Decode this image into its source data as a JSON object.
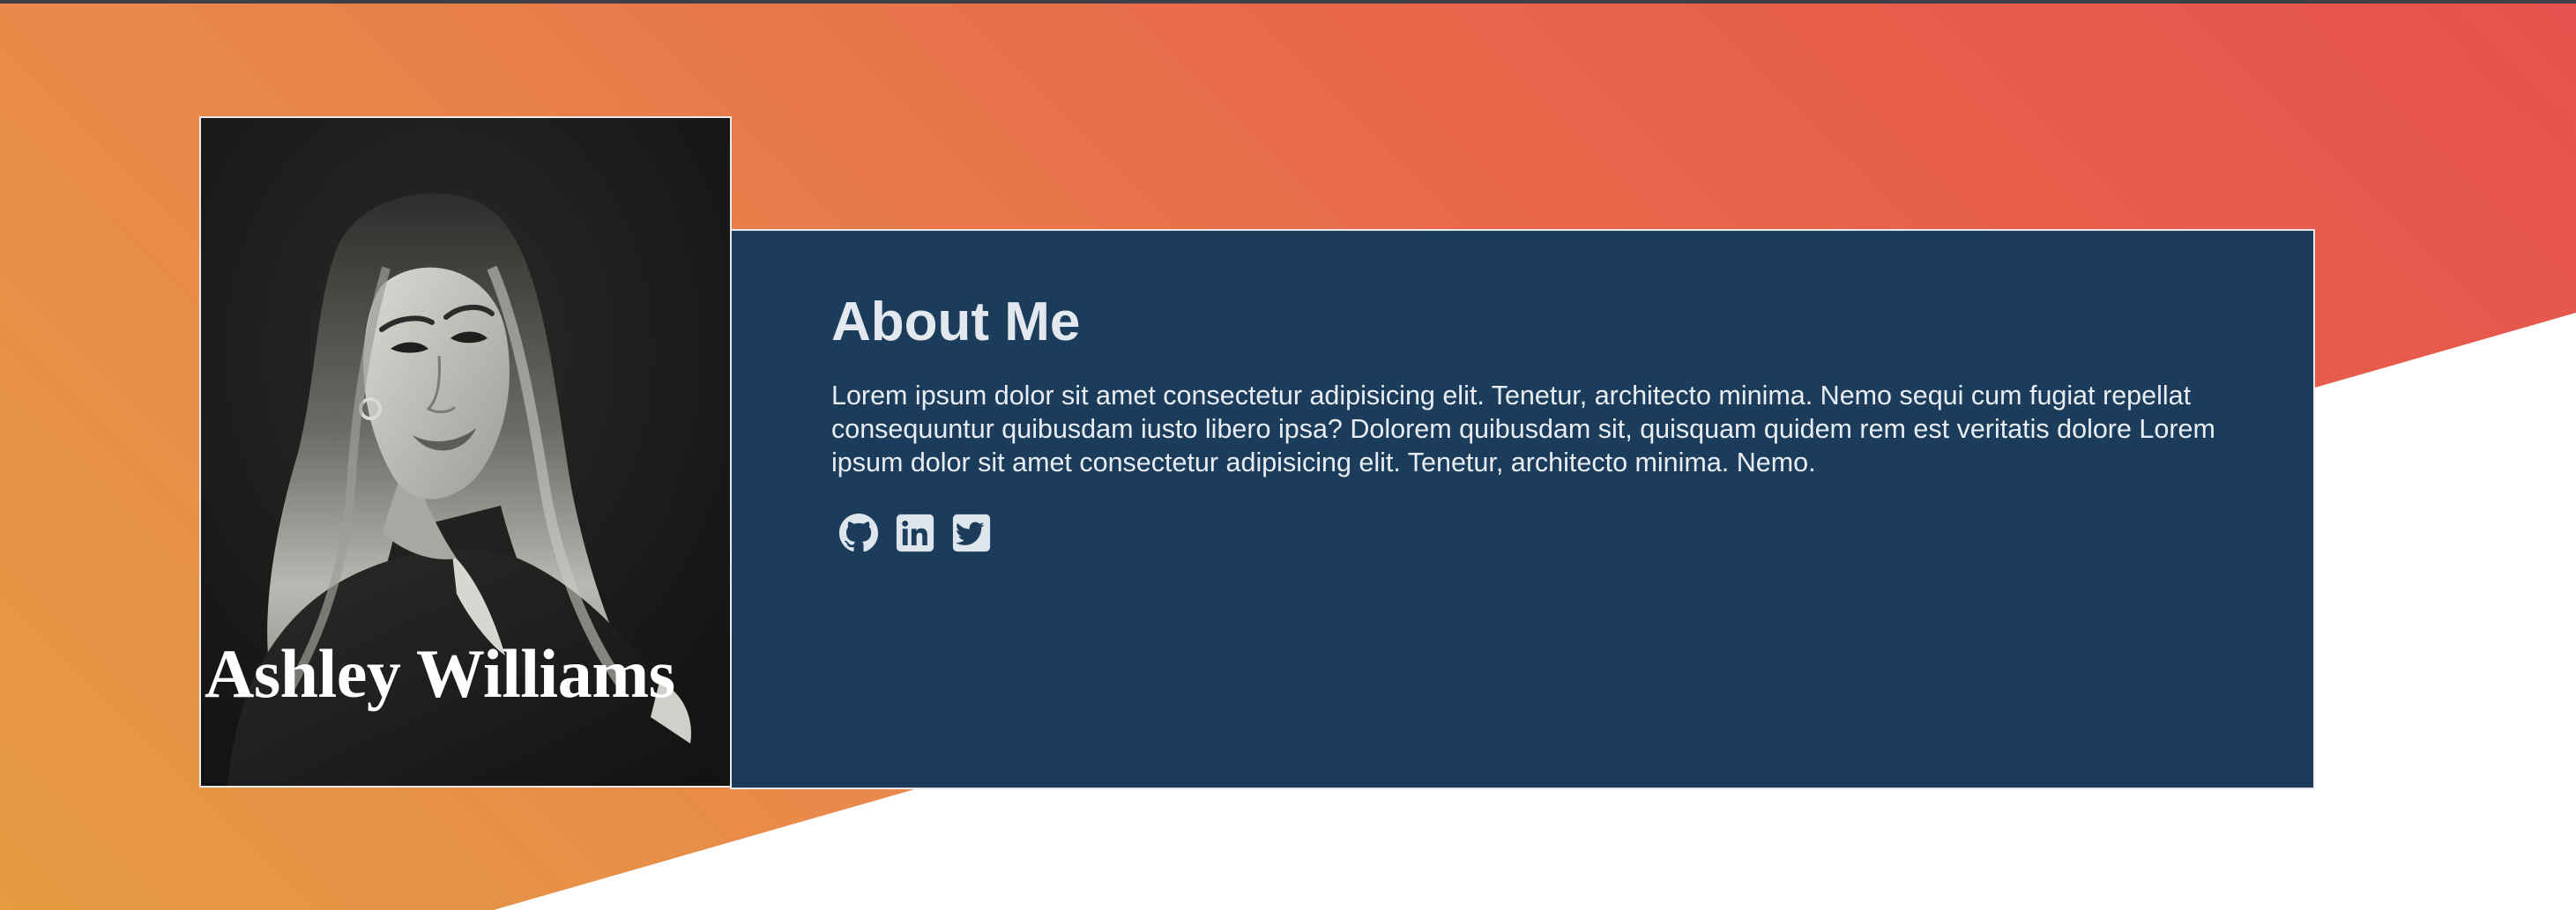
{
  "profile": {
    "name": "Ashley Williams",
    "photo_alt": "Ashley Williams portrait"
  },
  "about": {
    "heading": "About Me",
    "bio": "Lorem ipsum dolor sit amet consectetur adipisicing elit. Tenetur, architecto minima. Nemo sequi cum fugiat repellat consequuntur quibusdam iusto libero ipsa? Dolorem quibusdam sit, quisquam quidem rem est veritatis dolore Lorem ipsum dolor sit amet consectetur adipisicing elit. Tenetur, architecto minima. Nemo."
  },
  "socials": [
    {
      "icon": "github-icon",
      "label": "GitHub"
    },
    {
      "icon": "linkedin-icon",
      "label": "LinkedIn"
    },
    {
      "icon": "twitter-icon",
      "label": "Twitter"
    }
  ],
  "colors": {
    "gradient_start": "#e59b42",
    "gradient_end": "#e5524d",
    "panel": "#1c3c5c",
    "text": "#e3e8ee",
    "photo_bg": "#1b1c1a"
  }
}
